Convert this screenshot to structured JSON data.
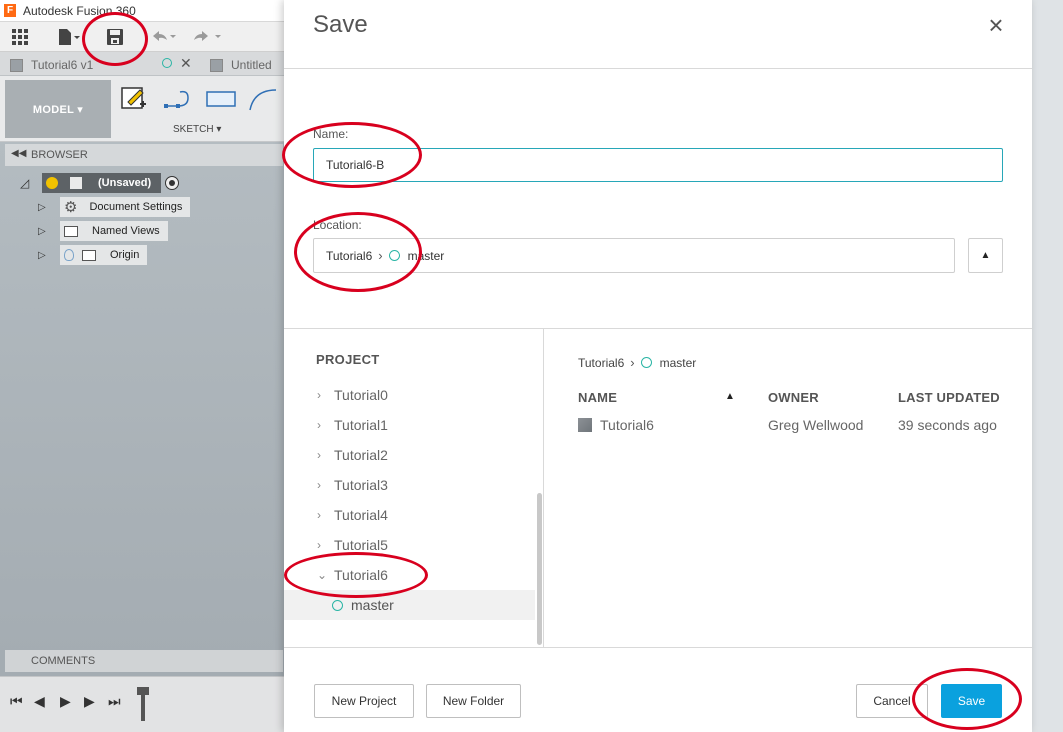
{
  "app": {
    "logo_letter": "F",
    "title": "Autodesk Fusion 360"
  },
  "tabs": [
    {
      "label": "Tutorial6 v1"
    },
    {
      "label": "Untitled"
    }
  ],
  "ribbon": {
    "workspace_label": "MODEL ▾",
    "sketch_label": "SKETCH ▾"
  },
  "browser": {
    "header": "BROWSER",
    "root_label": "(Unsaved)",
    "items": [
      {
        "label": "Document Settings",
        "icon": "gear-icon"
      },
      {
        "label": "Named Views",
        "icon": "folder-icon"
      },
      {
        "label": "Origin",
        "icon": "folder-icon"
      }
    ],
    "comments": "COMMENTS"
  },
  "dialog": {
    "title": "Save",
    "name_label": "Name:",
    "name_value": "Tutorial6-B",
    "location_label": "Location:",
    "location": {
      "project": "Tutorial6",
      "folder": "master"
    },
    "project_header": "PROJECT",
    "projects": [
      "Tutorial0",
      "Tutorial1",
      "Tutorial2",
      "Tutorial3",
      "Tutorial4",
      "Tutorial5",
      "Tutorial6"
    ],
    "expanded_folder": "master",
    "files_breadcrumb": {
      "project": "Tutorial6",
      "folder": "master"
    },
    "columns": {
      "name": "NAME",
      "owner": "OWNER",
      "updated": "LAST UPDATED"
    },
    "files": [
      {
        "name": "Tutorial6",
        "owner": "Greg Wellwood",
        "updated": "39 seconds ago"
      }
    ],
    "buttons": {
      "new_project": "New Project",
      "new_folder": "New Folder",
      "cancel": "Cancel",
      "save": "Save"
    }
  },
  "colors": {
    "accent_teal": "#27a7b8",
    "save_blue": "#0aa1de",
    "annotation_red": "#d8001e"
  }
}
